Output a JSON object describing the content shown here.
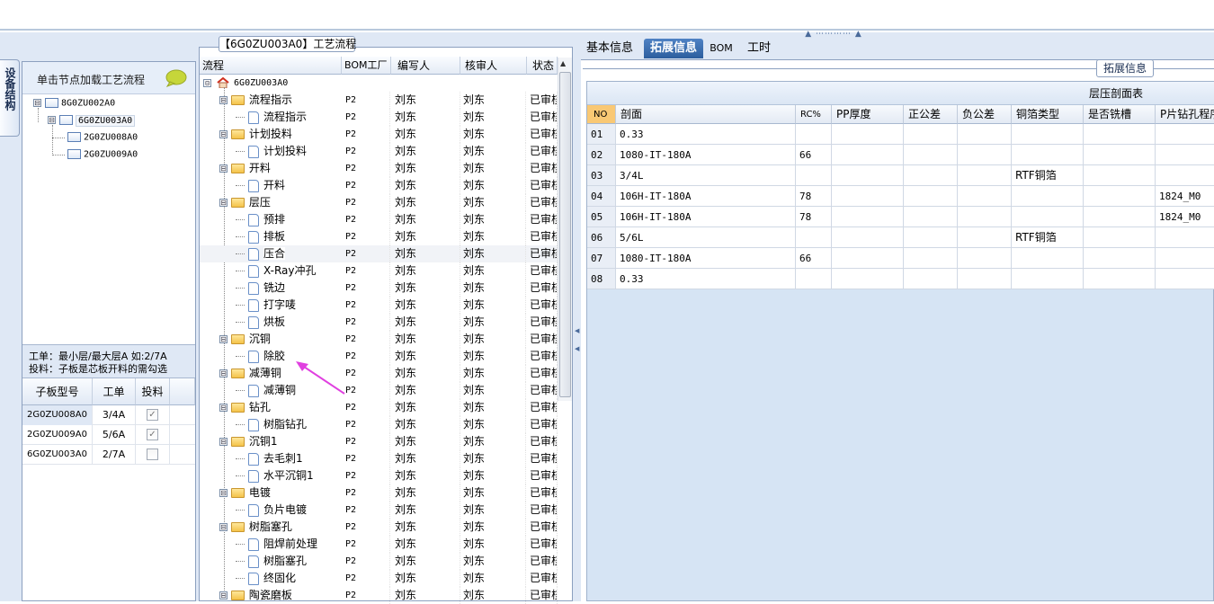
{
  "grip": "▲ ⋯⋯⋯⋯ ▲",
  "left_vertical_tab": "设备结构",
  "load_hint": "单击节点加载工艺流程",
  "structure_tree": [
    {
      "label": "8G0ZU002A0",
      "expander": "⊟"
    },
    {
      "label": "6G0ZU003A0",
      "expander": "⊟"
    },
    {
      "label": "2G0ZU008A0",
      "expander": ""
    },
    {
      "label": "2G0ZU009A0",
      "expander": ""
    }
  ],
  "tips": {
    "line1": "工单：最小层/最大层A 如:2/7A",
    "line2": "投料：子板是芯板开料的需勾选"
  },
  "subboard_grid": {
    "headers": [
      "子板型号",
      "工单",
      "投料"
    ],
    "rows": [
      {
        "model": "2G0ZU008A0",
        "order": "3/4A",
        "checked": true
      },
      {
        "model": "2G0ZU009A0",
        "order": "5/6A",
        "checked": true
      },
      {
        "model": "6G0ZU003A0",
        "order": "2/7A",
        "checked": false
      }
    ]
  },
  "process_panel": {
    "title": "【6G0ZU003A0】工艺流程",
    "headers": [
      "流程",
      "BOM工厂",
      "编写人",
      "核审人",
      "状态"
    ],
    "root": "6G0ZU003A0",
    "rows": [
      {
        "name": "流程指示",
        "type": "folder",
        "bom": "P2",
        "writer": "刘东",
        "reviewer": "刘东",
        "status": "已审核"
      },
      {
        "name": "流程指示",
        "type": "doc",
        "bom": "P2",
        "writer": "刘东",
        "reviewer": "刘东",
        "status": "已审核"
      },
      {
        "name": "计划投料",
        "type": "folder",
        "bom": "P2",
        "writer": "刘东",
        "reviewer": "刘东",
        "status": "已审核"
      },
      {
        "name": "计划投料",
        "type": "doc",
        "bom": "P2",
        "writer": "刘东",
        "reviewer": "刘东",
        "status": "已审核"
      },
      {
        "name": "开料",
        "type": "folder",
        "bom": "P2",
        "writer": "刘东",
        "reviewer": "刘东",
        "status": "已审核"
      },
      {
        "name": "开料",
        "type": "doc",
        "bom": "P2",
        "writer": "刘东",
        "reviewer": "刘东",
        "status": "已审核"
      },
      {
        "name": "层压",
        "type": "folder",
        "bom": "P2",
        "writer": "刘东",
        "reviewer": "刘东",
        "status": "已审核"
      },
      {
        "name": "预排",
        "type": "doc",
        "bom": "P2",
        "writer": "刘东",
        "reviewer": "刘东",
        "status": "已审核"
      },
      {
        "name": "排板",
        "type": "doc",
        "bom": "P2",
        "writer": "刘东",
        "reviewer": "刘东",
        "status": "已审核"
      },
      {
        "name": "压合",
        "type": "doc",
        "bom": "P2",
        "writer": "刘东",
        "reviewer": "刘东",
        "status": "已审核",
        "selected": true
      },
      {
        "name": "X-Ray冲孔",
        "type": "doc",
        "bom": "P2",
        "writer": "刘东",
        "reviewer": "刘东",
        "status": "已审核"
      },
      {
        "name": "铣边",
        "type": "doc",
        "bom": "P2",
        "writer": "刘东",
        "reviewer": "刘东",
        "status": "已审核"
      },
      {
        "name": "打字唛",
        "type": "doc",
        "bom": "P2",
        "writer": "刘东",
        "reviewer": "刘东",
        "status": "已审核"
      },
      {
        "name": "烘板",
        "type": "doc",
        "bom": "P2",
        "writer": "刘东",
        "reviewer": "刘东",
        "status": "已审核"
      },
      {
        "name": "沉铜",
        "type": "folder",
        "bom": "P2",
        "writer": "刘东",
        "reviewer": "刘东",
        "status": "已审核"
      },
      {
        "name": "除胶",
        "type": "doc",
        "bom": "P2",
        "writer": "刘东",
        "reviewer": "刘东",
        "status": "已审核"
      },
      {
        "name": "减薄铜",
        "type": "folder",
        "bom": "P2",
        "writer": "刘东",
        "reviewer": "刘东",
        "status": "已审核"
      },
      {
        "name": "减薄铜",
        "type": "doc",
        "bom": "P2",
        "writer": "刘东",
        "reviewer": "刘东",
        "status": "已审核"
      },
      {
        "name": "钻孔",
        "type": "folder",
        "bom": "P2",
        "writer": "刘东",
        "reviewer": "刘东",
        "status": "已审核"
      },
      {
        "name": "树脂钻孔",
        "type": "doc",
        "bom": "P2",
        "writer": "刘东",
        "reviewer": "刘东",
        "status": "已审核"
      },
      {
        "name": "沉铜1",
        "type": "folder",
        "bom": "P2",
        "writer": "刘东",
        "reviewer": "刘东",
        "status": "已审核"
      },
      {
        "name": "去毛刺1",
        "type": "doc",
        "bom": "P2",
        "writer": "刘东",
        "reviewer": "刘东",
        "status": "已审核"
      },
      {
        "name": "水平沉铜1",
        "type": "doc",
        "bom": "P2",
        "writer": "刘东",
        "reviewer": "刘东",
        "status": "已审核"
      },
      {
        "name": "电镀",
        "type": "folder",
        "bom": "P2",
        "writer": "刘东",
        "reviewer": "刘东",
        "status": "已审核"
      },
      {
        "name": "负片电镀",
        "type": "doc",
        "bom": "P2",
        "writer": "刘东",
        "reviewer": "刘东",
        "status": "已审核"
      },
      {
        "name": "树脂塞孔",
        "type": "folder",
        "bom": "P2",
        "writer": "刘东",
        "reviewer": "刘东",
        "status": "已审核"
      },
      {
        "name": "阻焊前处理",
        "type": "doc",
        "bom": "P2",
        "writer": "刘东",
        "reviewer": "刘东",
        "status": "已审核"
      },
      {
        "name": "树脂塞孔",
        "type": "doc",
        "bom": "P2",
        "writer": "刘东",
        "reviewer": "刘东",
        "status": "已审核"
      },
      {
        "name": "终固化",
        "type": "doc",
        "bom": "P2",
        "writer": "刘东",
        "reviewer": "刘东",
        "status": "已审核"
      },
      {
        "name": "陶瓷磨板",
        "type": "folder",
        "bom": "P2",
        "writer": "刘东",
        "reviewer": "刘东",
        "status": "已审核"
      }
    ]
  },
  "right_tabs": [
    "基本信息",
    "拓展信息",
    "BOM",
    "工时"
  ],
  "right_active_tab": "拓展信息",
  "right_caption": "拓展信息",
  "stackup": {
    "group_header": "层压剖面表",
    "headers": [
      "NO",
      "剖面",
      "RC%",
      "PP厚度",
      "正公差",
      "负公差",
      "铜箔类型",
      "是否铣槽",
      "P片钻孔程序"
    ],
    "rows": [
      {
        "no": "01",
        "section": "0.33",
        "rc": "",
        "pp": "",
        "pos": "",
        "neg": "",
        "foil": "",
        "slot": "",
        "drill": ""
      },
      {
        "no": "02",
        "section": "1080-IT-180A",
        "rc": "66",
        "pp": "",
        "pos": "",
        "neg": "",
        "foil": "",
        "slot": "",
        "drill": ""
      },
      {
        "no": "03",
        "section": "3/4L",
        "rc": "",
        "pp": "",
        "pos": "",
        "neg": "",
        "foil": "RTF铜箔",
        "slot": "",
        "drill": ""
      },
      {
        "no": "04",
        "section": "106H-IT-180A",
        "rc": "78",
        "pp": "",
        "pos": "",
        "neg": "",
        "foil": "",
        "slot": "",
        "drill": "1824_M0"
      },
      {
        "no": "05",
        "section": "106H-IT-180A",
        "rc": "78",
        "pp": "",
        "pos": "",
        "neg": "",
        "foil": "",
        "slot": "",
        "drill": "1824_M0"
      },
      {
        "no": "06",
        "section": "5/6L",
        "rc": "",
        "pp": "",
        "pos": "",
        "neg": "",
        "foil": "RTF铜箔",
        "slot": "",
        "drill": ""
      },
      {
        "no": "07",
        "section": "1080-IT-180A",
        "rc": "66",
        "pp": "",
        "pos": "",
        "neg": "",
        "foil": "",
        "slot": "",
        "drill": ""
      },
      {
        "no": "08",
        "section": "0.33",
        "rc": "",
        "pp": "",
        "pos": "",
        "neg": "",
        "foil": "",
        "slot": "",
        "drill": ""
      }
    ]
  },
  "colors": {
    "accent": "#2c5e9e",
    "panel_bg": "#dfe8f5",
    "arrow": "#e040e0",
    "folder": "#f4c34a",
    "no_col_active": "#f9c874"
  },
  "icons": [
    "speech-bubble-icon",
    "home-icon",
    "folder-icon",
    "document-icon",
    "checkbox-icon"
  ]
}
